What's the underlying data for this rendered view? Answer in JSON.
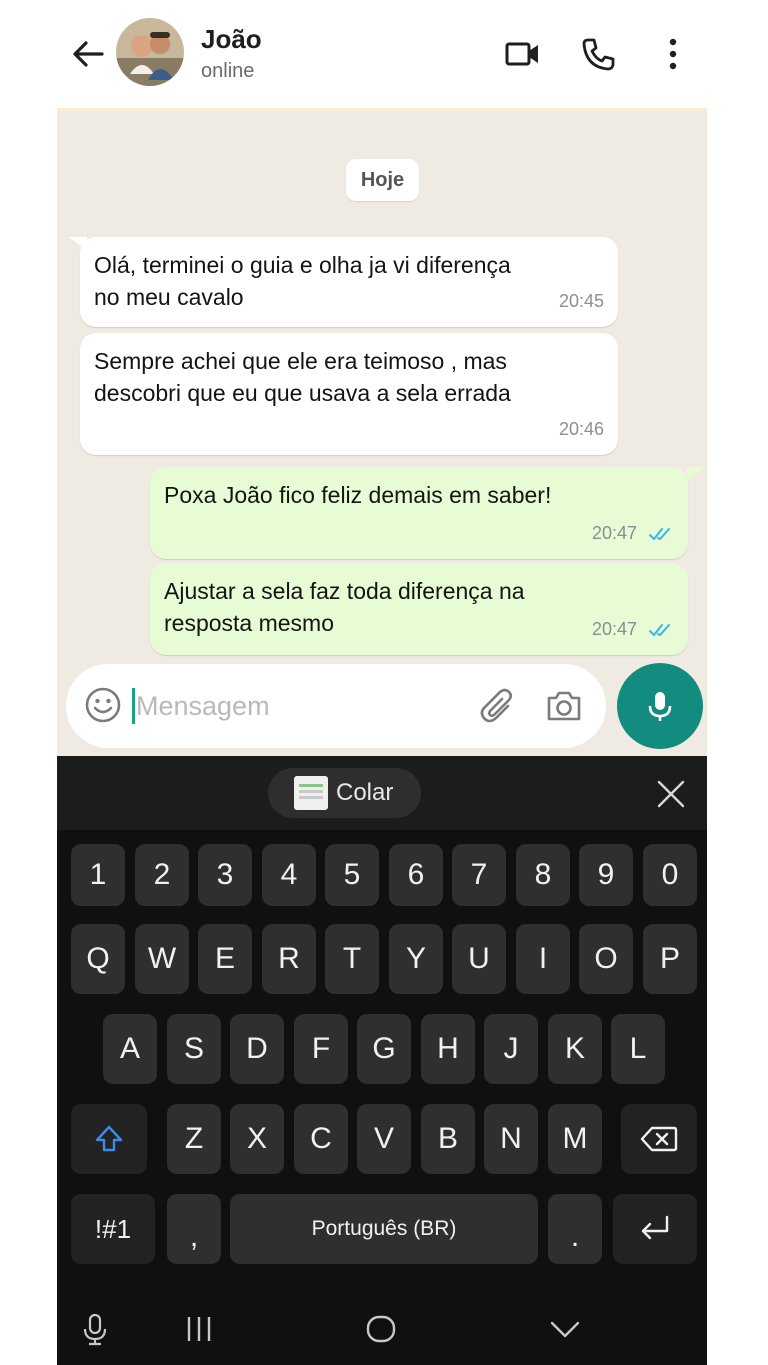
{
  "header": {
    "contact_name": "João",
    "contact_status": "online",
    "icons": [
      "back-arrow-icon",
      "video-call-icon",
      "phone-call-icon",
      "more-options-icon"
    ]
  },
  "chat": {
    "date_label": "Hoje",
    "messages": [
      {
        "direction": "incoming",
        "text": "Olá,  terminei o guia e olha ja vi diferença\nno meu cavalo",
        "time": "20:45"
      },
      {
        "direction": "incoming",
        "text": "Sempre achei que ele era teimoso , mas\ndescobri que eu que usava a sela errada",
        "time": "20:46"
      },
      {
        "direction": "outgoing",
        "text": "Poxa João fico feliz demais em saber!",
        "time": "20:47",
        "read": true
      },
      {
        "direction": "outgoing",
        "text": "Ajustar a sela faz toda diferença na\nresposta mesmo",
        "time": "20:47",
        "read": true
      }
    ]
  },
  "composer": {
    "placeholder": "Mensagem",
    "value": ""
  },
  "keyboard": {
    "paste_label": "Colar",
    "row_numbers": [
      "1",
      "2",
      "3",
      "4",
      "5",
      "6",
      "7",
      "8",
      "9",
      "0"
    ],
    "row_top": [
      "Q",
      "W",
      "E",
      "R",
      "T",
      "Y",
      "U",
      "I",
      "O",
      "P"
    ],
    "row_middle": [
      "A",
      "S",
      "D",
      "F",
      "G",
      "H",
      "J",
      "K",
      "L"
    ],
    "row_bottom": [
      "Z",
      "X",
      "C",
      "V",
      "B",
      "N",
      "M"
    ],
    "symbols_label": "!#1",
    "comma_label": ",",
    "space_label": "Português (BR)",
    "period_label": "."
  },
  "colors": {
    "incoming_bubble": "#ffffff",
    "outgoing_bubble": "#e7fcd4",
    "chat_background": "#efeae2",
    "accent": "#128c7e",
    "read_ticks": "#34b7f1"
  }
}
